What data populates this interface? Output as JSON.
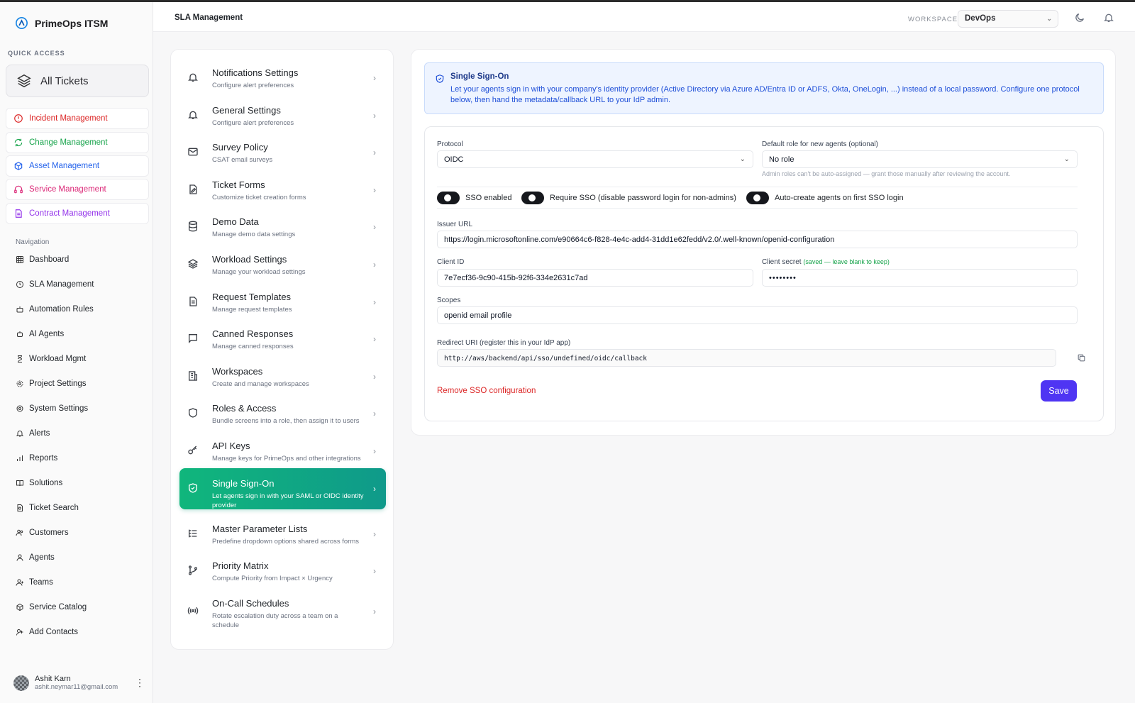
{
  "app": {
    "name": "PrimeOps ITSM"
  },
  "sidebar": {
    "quick_access_label": "QUICK ACCESS",
    "all_tickets": "All Tickets",
    "quick_items": [
      {
        "label": "Incident Management",
        "color": "#dc2626"
      },
      {
        "label": "Change Management",
        "color": "#16a34a"
      },
      {
        "label": "Asset Management",
        "color": "#2563eb"
      },
      {
        "label": "Service Management",
        "color": "#db2777"
      },
      {
        "label": "Contract Management",
        "color": "#9333ea"
      }
    ],
    "nav_label": "Navigation",
    "nav_items": [
      "Dashboard",
      "SLA Management",
      "Automation Rules",
      "AI Agents",
      "Workload Mgmt",
      "Project Settings",
      "System Settings",
      "Alerts",
      "Reports",
      "Solutions",
      "Ticket Search",
      "Customers",
      "Agents",
      "Teams",
      "Service Catalog",
      "Add Contacts"
    ],
    "user": {
      "name": "Ashit Karn",
      "email": "ashit.neymar11@gmail.com"
    }
  },
  "header": {
    "title": "SLA Management",
    "workspace_label": "WORKSPACE",
    "workspace_value": "DevOps"
  },
  "settings_menu": [
    {
      "title": "Notifications Settings",
      "desc": "Configure alert preferences"
    },
    {
      "title": "General Settings",
      "desc": "Configure alert preferences"
    },
    {
      "title": "Survey Policy",
      "desc": "CSAT email surveys"
    },
    {
      "title": "Ticket Forms",
      "desc": "Customize ticket creation forms"
    },
    {
      "title": "Demo Data",
      "desc": "Manage demo data settings"
    },
    {
      "title": "Workload Settings",
      "desc": "Manage your workload settings"
    },
    {
      "title": "Request Templates",
      "desc": "Manage request templates"
    },
    {
      "title": "Canned Responses",
      "desc": "Manage canned responses"
    },
    {
      "title": "Workspaces",
      "desc": "Create and manage workspaces"
    },
    {
      "title": "Roles & Access",
      "desc": "Bundle screens into a role, then assign it to users"
    },
    {
      "title": "API Keys",
      "desc": "Manage keys for PrimeOps and other integrations"
    },
    {
      "title": "Single Sign-On",
      "desc": "Let agents sign in with your SAML or OIDC identity provider"
    },
    {
      "title": "Master Parameter Lists",
      "desc": "Predefine dropdown options shared across forms"
    },
    {
      "title": "Priority Matrix",
      "desc": "Compute Priority from Impact × Urgency"
    },
    {
      "title": "On-Call Schedules",
      "desc": "Rotate escalation duty across a team on a schedule"
    }
  ],
  "sso": {
    "info_title": "Single Sign-On",
    "info_text": "Let your agents sign in with your company's identity provider (Active Directory via Azure AD/Entra ID or ADFS, Okta, OneLogin, ...) instead of a local password. Configure one protocol below, then hand the metadata/callback URL to your IdP admin.",
    "protocol_label": "Protocol",
    "protocol_value": "OIDC",
    "default_role_label": "Default role for new agents (optional)",
    "default_role_value": "No role",
    "default_role_hint": "Admin roles can't be auto-assigned — grant those manually after reviewing the account.",
    "toggles": [
      {
        "label": "SSO enabled",
        "on": true
      },
      {
        "label": "Require SSO (disable password login for non-admins)",
        "on": true
      },
      {
        "label": "Auto-create agents on first SSO login",
        "on": true
      }
    ],
    "issuer_label": "Issuer URL",
    "issuer_value": "https://login.microsoftonline.com/e90664c6-f828-4e4c-add4-31dd1e62fedd/v2.0/.well-known/openid-configuration",
    "client_id_label": "Client ID",
    "client_id_value": "7e7ecf36-9c90-415b-92f6-334e2631c7ad",
    "client_secret_label": "Client secret",
    "client_secret_note": "(saved — leave blank to keep)",
    "client_secret_value": "••••••••",
    "scopes_label": "Scopes",
    "scopes_value": "openid email profile",
    "redirect_label": "Redirect URI (register this in your IdP app)",
    "redirect_value": "http://aws/backend/api/sso/undefined/oidc/callback",
    "remove_label": "Remove SSO configuration",
    "save_label": "Save"
  }
}
